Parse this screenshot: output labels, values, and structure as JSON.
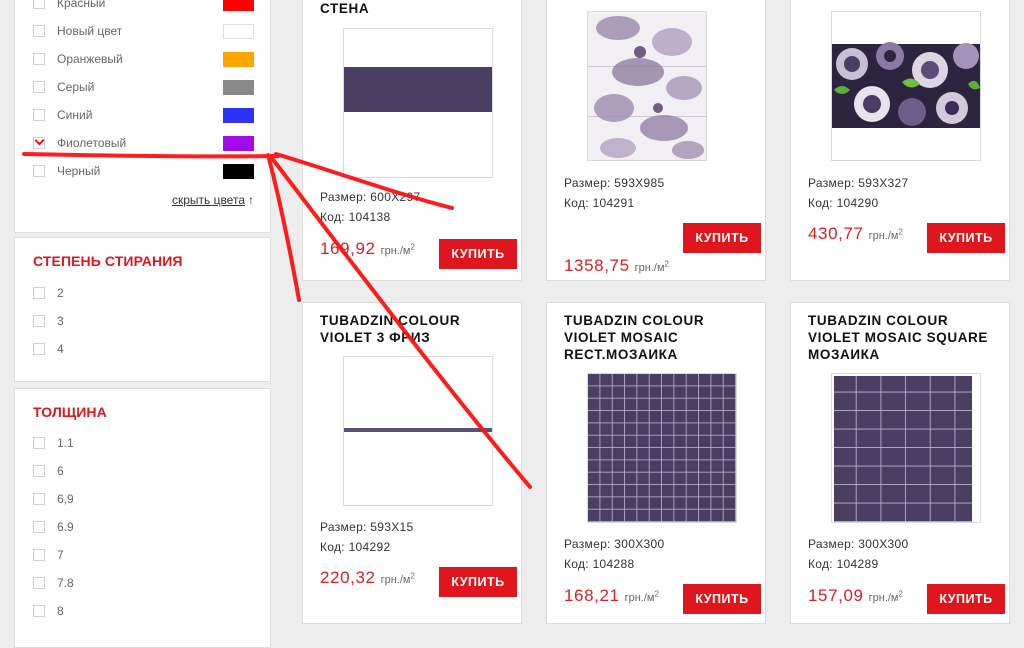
{
  "filters": {
    "colors": {
      "items": [
        {
          "label": "Красный",
          "checked": false,
          "swatch": "#ff0000"
        },
        {
          "label": "Новый цвет",
          "checked": false,
          "swatch": "#ffffff"
        },
        {
          "label": "Оранжевый",
          "checked": false,
          "swatch": "#ffa500"
        },
        {
          "label": "Серый",
          "checked": false,
          "swatch": "#888888"
        },
        {
          "label": "Синий",
          "checked": false,
          "swatch": "#2b33f5"
        },
        {
          "label": "Фиолетовый",
          "checked": true,
          "swatch": "#a30ae8"
        },
        {
          "label": "Черный",
          "checked": false,
          "swatch": "#000000"
        }
      ],
      "hide_link": "скрыть цвета",
      "hide_arrow": "↑"
    },
    "abrasion": {
      "title": "СТЕПЕНЬ СТИРАНИЯ",
      "items": [
        "2",
        "3",
        "4"
      ]
    },
    "thickness": {
      "title": "ТОЛЩИНА",
      "items": [
        "1.1",
        "6",
        "6,9",
        "6.9",
        "7",
        "7.8",
        "8"
      ]
    }
  },
  "products": [
    {
      "title": "СТЕНА",
      "size": "Размер: 600X297",
      "code": "Код: 104138",
      "price": "169,92",
      "unit": "грн./м",
      "unit_sup": "2",
      "buy_label": "КУПИТЬ",
      "image": "wall-stripe-icon"
    },
    {
      "title": "",
      "size": "Размер: 593X985",
      "code": "Код: 104291",
      "price": "1358,75",
      "unit": "грн./м",
      "unit_sup": "2",
      "buy_label": "КУПИТЬ",
      "image": "floral-panel-icon"
    },
    {
      "title": "",
      "size": "Размер: 593X327",
      "code": "Код: 104290",
      "price": "430,77",
      "unit": "грн./м",
      "unit_sup": "2",
      "buy_label": "КУПИТЬ",
      "image": "rose-decor-icon"
    },
    {
      "title": "TUBADZIN COLOUR VIOLET 3 ФРИЗ",
      "size": "Размер: 593X15",
      "code": "Код: 104292",
      "price": "220,32",
      "unit": "грн./м",
      "unit_sup": "2",
      "buy_label": "КУПИТЬ",
      "image": "frieze-line-icon"
    },
    {
      "title": "TUBADZIN COLOUR VIOLET MOSAIC RECT.МОЗАИКА",
      "size": "Размер: 300X300",
      "code": "Код: 104288",
      "price": "168,21",
      "unit": "грн./м",
      "unit_sup": "2",
      "buy_label": "КУПИТЬ",
      "image": "mosaic-grid-icon"
    },
    {
      "title": "TUBADZIN COLOUR VIOLET MOSAIC SQUARE МОЗАИКА",
      "size": "Размер: 300X300",
      "code": "Код: 104289",
      "price": "157,09",
      "unit": "грн./м",
      "unit_sup": "2",
      "buy_label": "КУПИТЬ",
      "image": "mosaic-brick-icon"
    }
  ],
  "colors": {
    "accent": "#e0161e",
    "price": "#d71f26",
    "tile_violet": "#4a3f63"
  }
}
